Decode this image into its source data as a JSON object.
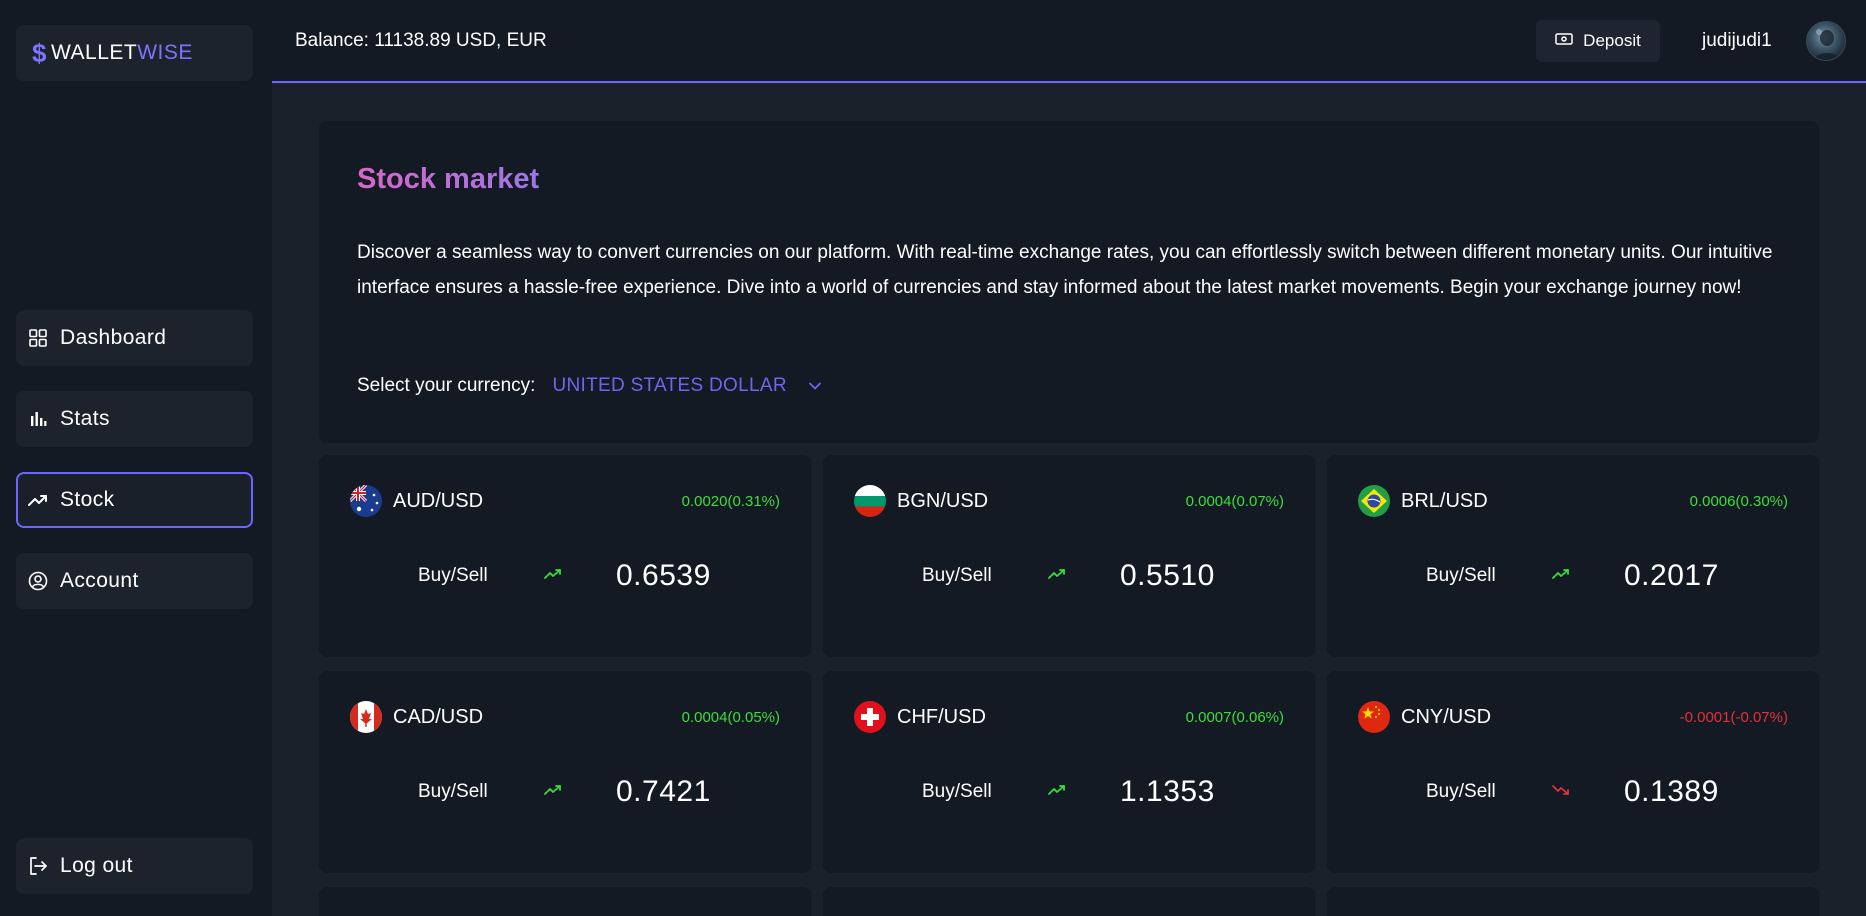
{
  "sidebar": {
    "logo": {
      "part1": "WALLET",
      "part2": "WISE"
    },
    "nav": [
      {
        "label": "Dashboard",
        "icon": "grid-icon"
      },
      {
        "label": "Stats",
        "icon": "bar-chart-icon"
      },
      {
        "label": "Stock",
        "icon": "trending-up-icon",
        "active": true
      },
      {
        "label": "Account",
        "icon": "user-circle-icon"
      }
    ],
    "logout": {
      "label": "Log out",
      "icon": "logout-icon"
    }
  },
  "header": {
    "balance": "Balance: 11138.89 USD, EUR",
    "deposit_label": "Deposit",
    "username": "judijudi1"
  },
  "main": {
    "title": "Stock market",
    "description": "Discover a seamless way to convert currencies on our platform. With real-time exchange rates, you can effortlessly switch between different monetary units. Our intuitive interface ensures a hassle-free experience. Dive into a world of currencies and stay informed about the latest market movements. Begin your exchange journey now!",
    "select_label": "Select your currency:",
    "selected_currency": "UNITED STATES DOLLAR"
  },
  "cards": [
    {
      "pair": "AUD/USD",
      "change": "0.0020(0.31%)",
      "direction": "up",
      "buy_sell": "Buy/Sell",
      "rate": "0.6539",
      "flag": "australia-flag"
    },
    {
      "pair": "BGN/USD",
      "change": "0.0004(0.07%)",
      "direction": "up",
      "buy_sell": "Buy/Sell",
      "rate": "0.5510",
      "flag": "bulgaria-flag"
    },
    {
      "pair": "BRL/USD",
      "change": "0.0006(0.30%)",
      "direction": "up",
      "buy_sell": "Buy/Sell",
      "rate": "0.2017",
      "flag": "brazil-flag"
    },
    {
      "pair": "CAD/USD",
      "change": "0.0004(0.05%)",
      "direction": "up",
      "buy_sell": "Buy/Sell",
      "rate": "0.7421",
      "flag": "canada-flag"
    },
    {
      "pair": "CHF/USD",
      "change": "0.0007(0.06%)",
      "direction": "up",
      "buy_sell": "Buy/Sell",
      "rate": "1.1353",
      "flag": "switzerland-flag"
    },
    {
      "pair": "CNY/USD",
      "change": "-0.0001(-0.07%)",
      "direction": "down",
      "buy_sell": "Buy/Sell",
      "rate": "0.1389",
      "flag": "china-flag"
    }
  ],
  "colors": {
    "accent": "#6b66ff",
    "positive": "#3ddc3d",
    "negative": "#e0303a",
    "panel": "#141a23",
    "background": "#1b212a"
  }
}
